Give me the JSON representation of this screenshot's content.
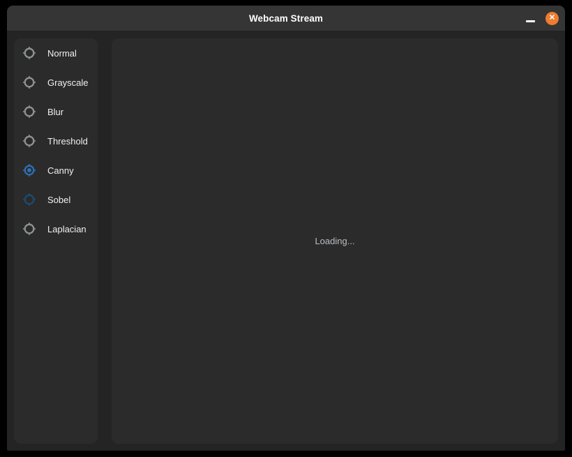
{
  "window": {
    "title": "Webcam Stream"
  },
  "icons": {
    "close_glyph": "✕",
    "minimize": "minimize-dash",
    "radio": "crosshair-radio"
  },
  "colors": {
    "accent_blue": "#2d6fb5",
    "focus_blue": "#1d4b72",
    "radio_gray": "#8e9295",
    "close_orange": "#ed7d2f",
    "panel_bg": "#2b2b2b",
    "window_bg": "#242424",
    "titlebar_bg": "#353535"
  },
  "sidebar": {
    "selected": "Canny",
    "items": [
      {
        "label": "Normal",
        "state": "default"
      },
      {
        "label": "Grayscale",
        "state": "default"
      },
      {
        "label": "Blur",
        "state": "default"
      },
      {
        "label": "Threshold",
        "state": "default"
      },
      {
        "label": "Canny",
        "state": "selected"
      },
      {
        "label": "Sobel",
        "state": "focus"
      },
      {
        "label": "Laplacian",
        "state": "default"
      }
    ]
  },
  "main": {
    "loading_text": "Loading..."
  }
}
